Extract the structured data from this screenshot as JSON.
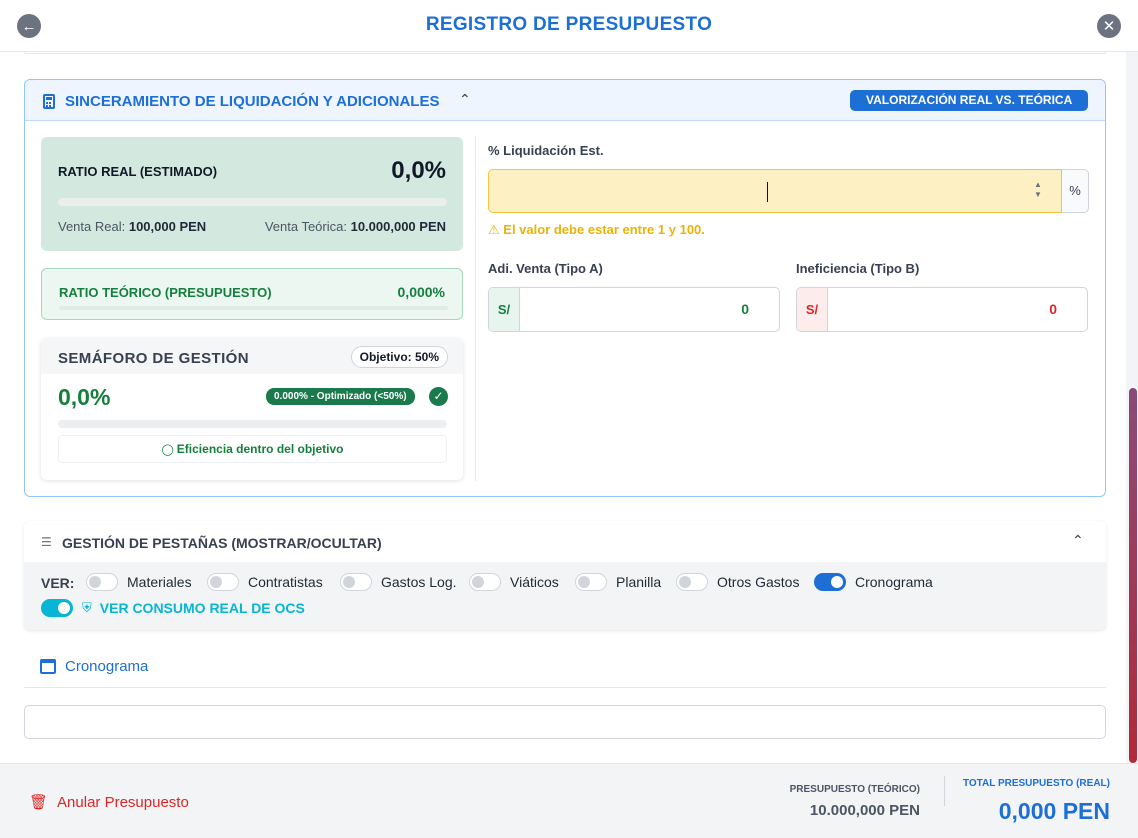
{
  "header": {
    "title": "REGISTRO DE PRESUPUESTO",
    "back_icon": "arrow-left-icon",
    "close_icon": "close-icon"
  },
  "sinceramiento": {
    "title": "SINCERAMIENTO DE LIQUIDACIÓN Y ADICIONALES",
    "badge": "VALORIZACIÓN REAL VS. TEÓRICA",
    "ratio_real": {
      "label": "RATIO REAL (ESTIMADO)",
      "value": "0,0%",
      "venta_real_label": "Venta Real:",
      "venta_real_value": "100,000 PEN",
      "venta_teorica_label": "Venta Teórica:",
      "venta_teorica_value": "10.000,000 PEN"
    },
    "ratio_teorico": {
      "label": "RATIO TEÓRICO (PRESUPUESTO)",
      "value": "0,000%"
    },
    "semaforo": {
      "label": "SEMÁFORO DE GESTIÓN",
      "objetivo": "Objetivo: 50%",
      "value": "0,0%",
      "status_pill": "0.000% - Optimizado (<50%)",
      "efficiency_text": "Eficiencia dentro del objetivo"
    },
    "liquidacion": {
      "label": "% Liquidación Est.",
      "value": "",
      "addon": "%",
      "warning": "El valor debe estar entre 1 y 100."
    },
    "adi_venta": {
      "label": "Adi. Venta (Tipo A)",
      "prefix": "S/",
      "value": "0"
    },
    "ineficiencia": {
      "label": "Ineficiencia (Tipo B)",
      "prefix": "S/",
      "value": "0"
    }
  },
  "tabs_manager": {
    "title": "GESTIÓN DE PESTAÑAS (MOSTRAR/OCULTAR)",
    "ver_label": "VER:",
    "toggles": [
      {
        "label": "Materiales",
        "on": false
      },
      {
        "label": "Contratistas",
        "on": false
      },
      {
        "label": "Gastos Log.",
        "on": false
      },
      {
        "label": "Viáticos",
        "on": false
      },
      {
        "label": "Planilla",
        "on": false
      },
      {
        "label": "Otros Gastos",
        "on": false
      },
      {
        "label": "Cronograma",
        "on": true
      }
    ],
    "ocs_toggle": {
      "label": "VER CONSUMO REAL DE OCS",
      "on": true
    }
  },
  "active_tab": {
    "label": "Cronograma",
    "icon": "calendar-icon"
  },
  "footer": {
    "anular_label": "Anular Presupuesto",
    "presupuesto_teorico_label": "PRESUPUESTO (TEÓRICO)",
    "presupuesto_teorico_value": "10.000,000 PEN",
    "total_real_label": "TOTAL PRESUPUESTO (REAL)",
    "total_real_value": "0,000 PEN"
  },
  "colors": {
    "accent": "#1d6fd6",
    "success": "#15803d",
    "danger": "#dc2626",
    "warning": "#eab308",
    "cyan": "#06b6d4"
  }
}
